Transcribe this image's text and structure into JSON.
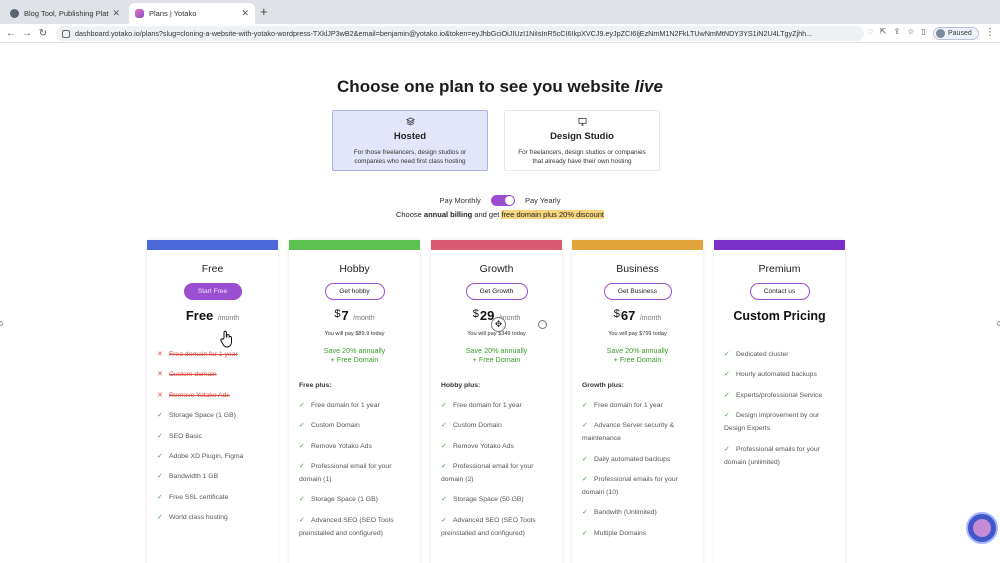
{
  "browser": {
    "tabs": [
      {
        "title": "Blog Tool, Publishing Platform",
        "active": false
      },
      {
        "title": "Plans | Yotako",
        "active": true
      }
    ],
    "url": "dashboard.yotako.io/plans?slug=cloning-a-website-with-yotako-wordpress-TXklJP3wB2&email=benjamin@yotako.io&token=eyJhbGciOiJIUzI1NiIsInR5cCI6IkpXVCJ9.eyJpZCI6IjEzNmM1N2FkLTUwNmMtNDY3YS1iN2U4LTgyZjhh...",
    "profile_label": "Paused"
  },
  "header": {
    "title_prefix": "Choose one plan to see you website ",
    "title_emph": "live"
  },
  "plan_types": [
    {
      "icon": "layers-icon",
      "title": "Hosted",
      "desc": "For those freelancers, design studios or companies who need first class hosting",
      "selected": true
    },
    {
      "icon": "monitor-icon",
      "title": "Design Studio",
      "desc": "For freelancers, design studios or companies that already have their own hosting",
      "selected": false
    }
  ],
  "billing": {
    "monthly": "Pay Monthly",
    "yearly": "Pay Yearly",
    "promo_before": "Choose ",
    "promo_bold": "annual billing",
    "promo_mid": " and get ",
    "promo_highlight": "free domain plus 20% discount"
  },
  "colors": {
    "free": "#4a68d8",
    "hobby": "#5cc14e",
    "growth": "#d75a72",
    "business": "#e2a43a",
    "premium": "#7a2fc8",
    "accent": "#9b4fd0"
  },
  "plans": {
    "free": {
      "name": "Free",
      "cta": "Start Free",
      "price_amount": "Free",
      "price_period": "/month",
      "features": [
        {
          "text": "Free domain for 1 year",
          "included": false
        },
        {
          "text": "Custom domain",
          "included": false
        },
        {
          "text": "Remove Yotako Ads",
          "included": false
        },
        {
          "text": "Storage Space (1 GB)",
          "included": true
        },
        {
          "text": "SEO Basic",
          "included": true
        },
        {
          "text": "Adobe XD Plugin, Figma",
          "included": true
        },
        {
          "text": "Bandwidth 1 GB",
          "included": true
        },
        {
          "text": "Free SSL certificate",
          "included": true
        },
        {
          "text": "World class hosting",
          "included": true
        }
      ]
    },
    "hobby": {
      "name": "Hobby",
      "cta": "Get hobby",
      "currency": "$",
      "price_amount": "7",
      "price_period": "/month",
      "annual_note": "You will pay $89.9 today",
      "save_line1": "Save 20% annually",
      "save_line2": "+ Free Domain",
      "plus_label": "Free plus:",
      "features": [
        "Free domain for 1 year",
        "Custom Domain",
        "Remove Yotako Ads",
        "Professional email for your domain (1)",
        "Storage Space (1 GB)",
        "Advanced SEO (SEO Tools preinstalled and configured)"
      ]
    },
    "growth": {
      "name": "Growth",
      "cta": "Get Growth",
      "currency": "$",
      "price_amount": "29",
      "price_period": "/month",
      "annual_note": "You will pay $349 today",
      "save_line1": "Save 20% annually",
      "save_line2": "+ Free Domain",
      "plus_label": "Hobby plus:",
      "features": [
        "Free domain for 1 year",
        "Custom Domain",
        "Remove Yotako Ads",
        "Professional email for your domain (2)",
        "Storage Space (50 GB)",
        "Advanced SEO (SEO Tools preinstalled and configured)"
      ]
    },
    "business": {
      "name": "Business",
      "cta": "Get Business",
      "currency": "$",
      "price_amount": "67",
      "price_period": "/month",
      "annual_note": "You will pay $799 today",
      "save_line1": "Save 20% annually",
      "save_line2": "+ Free Domain",
      "plus_label": "Growth plus:",
      "features": [
        "Free domain for 1 year",
        "Advance Server security & maintenance",
        "Daily automated backups",
        "Professional emails for your domain (10)",
        "Bandwith (Unlimited)",
        "Multiple Domains"
      ]
    },
    "premium": {
      "name": "Premium",
      "cta": "Contact us",
      "price_custom": "Custom Pricing",
      "features": [
        "Dedicated cluster",
        "Hourly automated backups",
        "Experts/professional Service",
        "Design improvement by our Design Experts",
        "Professional emails for your domain (unlimited)"
      ]
    }
  }
}
